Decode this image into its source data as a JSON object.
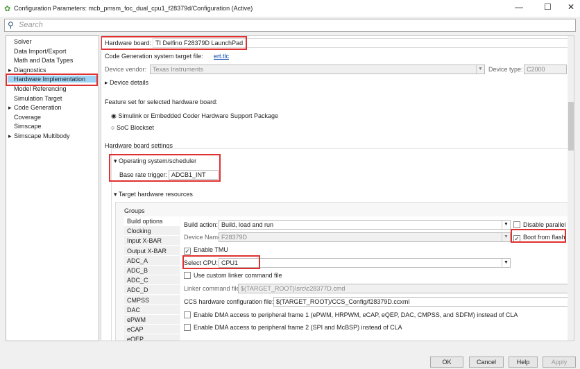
{
  "window": {
    "title": "Configuration Parameters: mcb_pmsm_foc_dual_cpu1_f28379d/Configuration (Active)"
  },
  "search": {
    "placeholder": "Search"
  },
  "tree": [
    "Solver",
    "Data Import/Export",
    "Math and Data Types",
    "Diagnostics",
    "Hardware Implementation",
    "Model Referencing",
    "Simulation Target",
    "Code Generation",
    "Coverage",
    "Simscape",
    "Simscape Multibody"
  ],
  "main": {
    "hw_board_label": "Hardware board:",
    "hw_board_value": "TI Delfino F28379D LaunchPad",
    "codegen_label": "Code Generation system target file:",
    "codegen_link": "ert.tlc",
    "vendor_label": "Device vendor:",
    "vendor_value": "Texas Instruments",
    "type_label": "Device type:",
    "type_value": "C2000",
    "device_details": "Device details",
    "feature_label": "Feature set for selected hardware board:",
    "radio1": "Simulink or Embedded Coder Hardware Support Package",
    "radio2": "SoC Blockset",
    "settings_label": "Hardware board settings",
    "os_label": "Operating system/scheduler",
    "base_rate_label": "Base rate trigger:",
    "base_rate_value": "ADCB1_INT",
    "thr_label": "Target hardware resources",
    "groups_label": "Groups",
    "groups": [
      "Build options",
      "Clocking",
      "Input X-BAR",
      "Output X-BAR",
      "ADC_A",
      "ADC_B",
      "ADC_C",
      "ADC_D",
      "CMPSS",
      "DAC",
      "ePWM",
      "eCAP",
      "eQEP"
    ],
    "build_action_label": "Build action:",
    "build_action_value": "Build, load and run",
    "disable_parallel": "Disable parallel",
    "device_name_label": "Device Name:",
    "device_name_value": "F28379D",
    "boot_flash": "Boot from flash",
    "enable_tmu": "Enable TMU",
    "cpu_label": "Select CPU:",
    "cpu_value": "CPU1",
    "custom_linker": "Use custom linker command file",
    "linker_label": "Linker command file:",
    "linker_value": "$(TARGET_ROOT)\\src\\c28377D.cmd",
    "ccs_label": "CCS hardware configuration file:",
    "ccs_value": "$(TARGET_ROOT)/CCS_Config/f28379D.ccxml",
    "dma1": "Enable DMA access to peripheral frame 1 (ePWM, HRPWM, eCAP, eQEP, DAC, CMPSS, and SDFM) instead of CLA",
    "dma2": "Enable DMA access to peripheral frame 2 (SPI and McBSP) instead of CLA"
  },
  "buttons": {
    "ok": "OK",
    "cancel": "Cancel",
    "help": "Help",
    "apply": "Apply"
  }
}
